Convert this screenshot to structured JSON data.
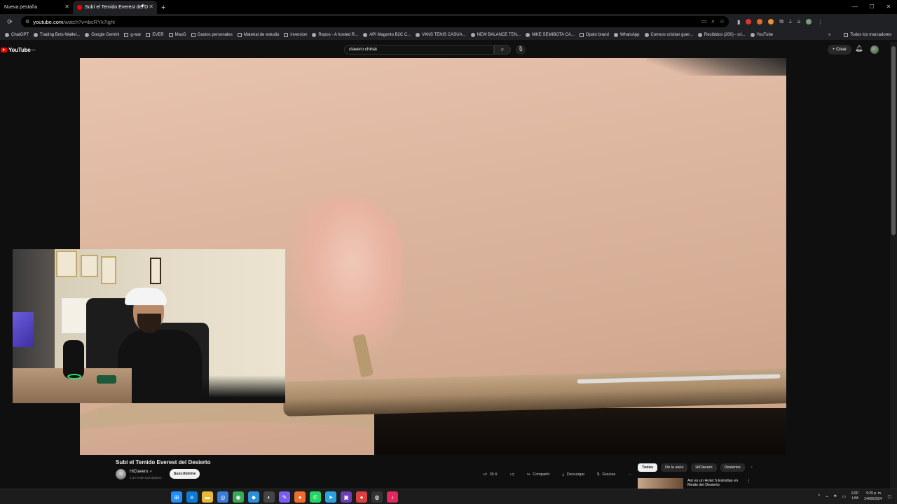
{
  "browser": {
    "tabs": [
      {
        "label": "Nueva pestaña",
        "active": false
      },
      {
        "label": "Subí el Temido Everest del D",
        "active": true
      }
    ],
    "new_tab_icon": "+",
    "window_controls": [
      "minimize-icon",
      "maximize-icon",
      "close-icon"
    ],
    "url_host": "youtube.com",
    "url_path": "/watch?v=ibcRYk7ighI",
    "bookmarks": [
      {
        "label": "ChatGPT",
        "icon": "chatgpt-icon"
      },
      {
        "label": "Trading Bots-Wallet...",
        "icon": "bookmark-icon"
      },
      {
        "label": "Google Gemini",
        "icon": "gemini-icon"
      },
      {
        "label": "g-war",
        "icon": "folder-icon"
      },
      {
        "label": "EVER",
        "icon": "folder-icon"
      },
      {
        "label": "MasG",
        "icon": "folder-icon"
      },
      {
        "label": "Gastos personales",
        "icon": "folder-icon"
      },
      {
        "label": "Material de estudio",
        "icon": "folder-icon"
      },
      {
        "label": "inversion",
        "icon": "folder-icon"
      },
      {
        "label": "Repos - A hosted R...",
        "icon": "globe-icon"
      },
      {
        "label": "API Magento B2C C...",
        "icon": "globe-icon"
      },
      {
        "label": "VANS TENIS CASUA...",
        "icon": "globe-icon"
      },
      {
        "label": "NEW BALANCE TEN...",
        "icon": "globe-icon"
      },
      {
        "label": "NIKE SEMIBOTA CA...",
        "icon": "globe-icon"
      },
      {
        "label": "Opalo brand",
        "icon": "folder-icon"
      },
      {
        "label": "WhatsApp",
        "icon": "whatsapp-icon"
      },
      {
        "label": "Correos cristian guer...",
        "icon": "mail-icon"
      },
      {
        "label": "Recibidos (200) - cri...",
        "icon": "gmail-icon"
      },
      {
        "label": "YouTube",
        "icon": "youtube-icon"
      }
    ],
    "all_bookmarks_label": "Todos los marcadores"
  },
  "youtube": {
    "logo_text": "YouTube",
    "logo_region": "CO",
    "search_value": "clavero china\\",
    "create_label": "Crear",
    "video": {
      "title": "Subí el Temido Everest del Desierto",
      "channel": "HiClavero",
      "subscribers": "1,44 M de suscriptores",
      "subscribe_label": "Suscribirme",
      "likes": "26 K",
      "share_label": "Compartir",
      "download_label": "Descargar",
      "thanks_label": "Gracias",
      "more_label": "···"
    },
    "chips": [
      "Todos",
      "De la serie",
      "HiClavero",
      "Desiertos"
    ],
    "recommendation_title": "Así es un Hotel 5 Estrellas en Medio del Desierto"
  },
  "taskbar": {
    "apps": [
      {
        "name": "windows-start-icon",
        "glyph": "⊞",
        "color": "#1e90ff"
      },
      {
        "name": "edge-icon",
        "glyph": "e",
        "color": "#0b7bd6"
      },
      {
        "name": "file-explorer-icon",
        "glyph": "▬",
        "color": "#e8b838"
      },
      {
        "name": "app-icon",
        "glyph": "◎",
        "color": "#3a7bd5"
      },
      {
        "name": "chrome-icon",
        "glyph": "◉",
        "color": "#3aa757"
      },
      {
        "name": "vscode-icon",
        "glyph": "◆",
        "color": "#2b8ed9"
      },
      {
        "name": "cursor-icon",
        "glyph": "◐",
        "color": "#444"
      },
      {
        "name": "pen-icon",
        "glyph": "✎",
        "color": "#7a5cf0"
      },
      {
        "name": "postman-icon",
        "glyph": "●",
        "color": "#ef6c2f"
      },
      {
        "name": "whatsapp-icon",
        "glyph": "✆",
        "color": "#25d366"
      },
      {
        "name": "telegram-icon",
        "glyph": "➤",
        "color": "#2aa3e0"
      },
      {
        "name": "visual-studio-icon",
        "glyph": "▣",
        "color": "#6a3fb5"
      },
      {
        "name": "app-red-icon",
        "glyph": "●",
        "color": "#d93f3f"
      },
      {
        "name": "obs-icon",
        "glyph": "◍",
        "color": "#333"
      },
      {
        "name": "tiktok-icon",
        "glyph": "♪",
        "color": "#e2265e"
      }
    ],
    "lang_top": "ESP",
    "lang_bottom": "LAA",
    "time": "9:29 p. m.",
    "date": "24/09/2024"
  },
  "colors": {
    "youtube_red": "#ff0000",
    "background": "#0f0f0f"
  }
}
